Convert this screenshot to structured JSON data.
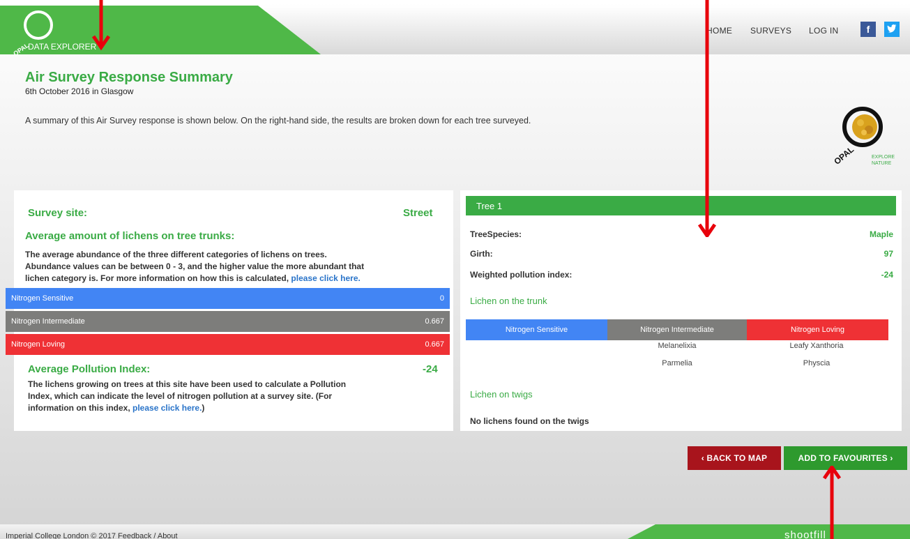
{
  "header": {
    "logo_text": "DATA EXPLORER",
    "logo_opal": "OPAL",
    "nav": [
      "HOME",
      "SURVEYS",
      "LOG IN"
    ],
    "social": {
      "facebook": "f",
      "twitter": "t"
    }
  },
  "page": {
    "title": "Air Survey Response Summary",
    "subtitle": "6th October 2016 in Glasgow",
    "description": "A summary of this Air Survey response is shown below. On the right-hand side, the results are broken down for each tree surveyed.",
    "badge_opal": "OPAL",
    "badge_tagline_1": "EXPLORE",
    "badge_tagline_2": "NATURE"
  },
  "left": {
    "site_label": "Survey site:",
    "site_value": "Street",
    "avg_lichen_heading": "Average amount of lichens on tree trunks:",
    "avg_lichen_text_1": "The average abundance of the three different categories of lichens on trees.",
    "avg_lichen_text_2": "Abundance values can be between 0 - 3, and the higher value the more abundant that",
    "avg_lichen_text_3": "lichen category is. For more information on how this is calculated,",
    "avg_lichen_link": "please click here.",
    "bars": [
      {
        "label": "Nitrogen Sensitive",
        "value": "0",
        "color": "#4285f4"
      },
      {
        "label": "Nitrogen Intermediate",
        "value": "0.667",
        "color": "#7d7d7b"
      },
      {
        "label": "Nitrogen Loving",
        "value": "0.667",
        "color": "#ef3135"
      }
    ],
    "pollution_heading": "Average Pollution Index:",
    "pollution_value": "-24",
    "pollution_text_1": "The lichens growing on trees at this site have been used to calculate a Pollution",
    "pollution_text_2": "Index, which can indicate the level of nitrogen pollution at a survey site. (For",
    "pollution_text_3": "information on this index,",
    "pollution_link": "please click here.",
    "pollution_close": ")"
  },
  "tree": {
    "header": "Tree 1",
    "rows": [
      {
        "label": "TreeSpecies:",
        "value": "Maple"
      },
      {
        "label": "Girth:",
        "value": "97"
      },
      {
        "label": "Weighted pollution index:",
        "value": "-24"
      }
    ],
    "trunk_heading": "Lichen on the trunk",
    "categories": [
      {
        "label": "Nitrogen Sensitive",
        "color": "#4285f4"
      },
      {
        "label": "Nitrogen Intermediate",
        "color": "#7d7d7b"
      },
      {
        "label": "Nitrogen Loving",
        "color": "#ef3135"
      }
    ],
    "intermediate_species": [
      "Melanelixia",
      "Parmelia"
    ],
    "loving_species": [
      "Leafy Xanthoria",
      "Physcia"
    ],
    "twigs_heading": "Lichen on twigs",
    "twigs_text": "No lichens found on the twigs"
  },
  "buttons": {
    "back": "‹ BACK TO MAP",
    "favourites": "ADD TO FAVOURITES ›",
    "back_color": "#a8141c",
    "fav_color": "#2e9a2e"
  },
  "footer": {
    "text": "Imperial College London © 2017 Feedback / About",
    "brand": "shootfill"
  },
  "icons": [
    "opal-logo-icon",
    "facebook-icon",
    "twitter-icon",
    "opal-badge-icon",
    "arrow-icon"
  ]
}
